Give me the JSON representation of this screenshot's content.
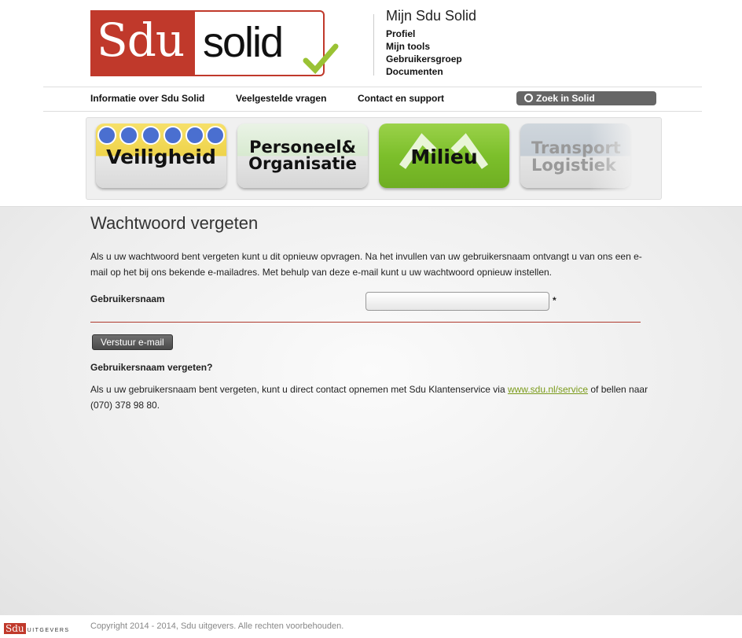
{
  "logo": {
    "brand_left": "Sdu",
    "brand_right": "solid"
  },
  "mijn": {
    "title": "Mijn Sdu Solid",
    "links": [
      "Profiel",
      "Mijn tools",
      "Gebruikersgroep",
      "Documenten"
    ]
  },
  "nav": {
    "items": [
      "Informatie over Sdu Solid",
      "Veelgestelde vragen",
      "Contact en support"
    ],
    "search_label": "Zoek in Solid"
  },
  "banner": {
    "tiles": [
      "Veiligheid",
      "Personeel& Organisatie",
      "Milieu",
      "Transport Logistiek"
    ]
  },
  "page": {
    "title": "Wachtwoord vergeten",
    "intro": "Als u uw wachtwoord bent vergeten kunt u dit opnieuw opvragen. Na het invullen van uw gebruikersnaam ontvangt u van ons een e-mail op het bij ons bekende e-mailadres. Met behulp van deze e-mail kunt u uw wachtwoord opnieuw instellen.",
    "field_label": "Gebruikersnaam",
    "field_value": "",
    "required_mark": "*",
    "submit_label": "Verstuur e-mail",
    "forgot_title": "Gebruikersnaam vergeten?",
    "forgot_text_1": "Als u uw gebruikersnaam bent vergeten, kunt u direct contact opnemen met Sdu Klantenservice via ",
    "forgot_link": "www.sdu.nl/service",
    "forgot_text_2": " of bellen naar (070) 378 98 80."
  },
  "footer": {
    "logo_text": "Sdu",
    "logo_sub": "UITGEVERS",
    "copyright": "Copyright 2014 - 2014, Sdu uitgevers. Alle rechten voorbehouden."
  },
  "colors": {
    "brand_red": "#c0392b",
    "link_green": "#7a9a1a",
    "check_green": "#9ac234"
  }
}
